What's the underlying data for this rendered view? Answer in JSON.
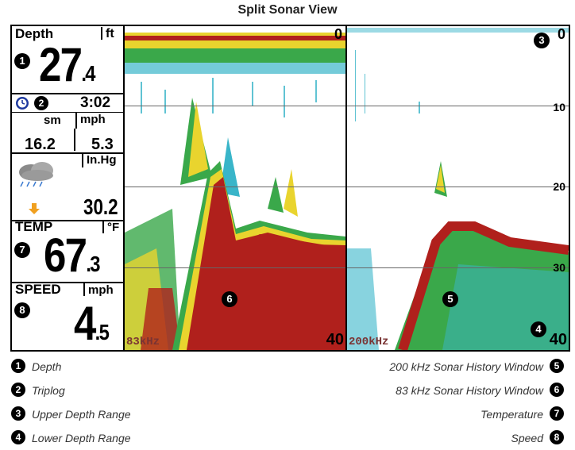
{
  "title": "Split Sonar View",
  "left_panel": {
    "depth_label": "Depth",
    "depth_unit": "ft",
    "depth_value": "27.4",
    "depth_int": "27",
    "depth_dec": ".4",
    "time": "3:02",
    "dist_unit": "sm",
    "speed_unit_small": "mph",
    "distance": "16.2",
    "trip_speed": "5.3",
    "pressure_unit": "In.Hg",
    "pressure": "30.2",
    "temp_label": "TEMP",
    "temp_unit": "°F",
    "temp_int": "67",
    "temp_dec": ".3",
    "speed_label": "SPEED",
    "speed_unit": "mph",
    "speed_int": "4",
    "speed_dec": ".5"
  },
  "sonar_left": {
    "frequency": "83kHz",
    "top_depth": "0",
    "bottom_depth": "40"
  },
  "sonar_right": {
    "frequency": "200kHz",
    "top_depth": "0",
    "bottom_depth": "40",
    "scale_ticks": [
      "10",
      "20",
      "30"
    ]
  },
  "callouts": [
    "1",
    "2",
    "3",
    "4",
    "5",
    "6",
    "7",
    "8"
  ],
  "legend_left": [
    {
      "num": "1",
      "text": "Depth"
    },
    {
      "num": "2",
      "text": "Triplog"
    },
    {
      "num": "3",
      "text": "Upper Depth Range"
    },
    {
      "num": "4",
      "text": "Lower Depth Range"
    }
  ],
  "legend_right": [
    {
      "num": "5",
      "text": "200 kHz Sonar History Window"
    },
    {
      "num": "6",
      "text": "83 kHz Sonar History Window"
    },
    {
      "num": "7",
      "text": "Temperature"
    },
    {
      "num": "8",
      "text": "Speed"
    }
  ],
  "colors": {
    "bottom_red": "#b0201c",
    "green_noise": "#3aa84a",
    "cyan_noise": "#39b5c9",
    "yellow": "#e9d42e",
    "clock_blue": "#1f3aa0",
    "arrow_orange": "#f0a020"
  },
  "icons": [
    "clock-icon",
    "cloud-rain-icon",
    "arrow-down-icon"
  ]
}
